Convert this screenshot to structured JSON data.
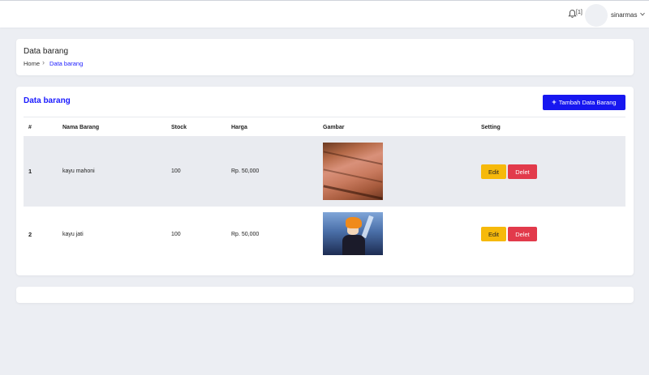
{
  "topbar": {
    "notification_count": "[1]",
    "username": "sinarmas"
  },
  "header": {
    "title": "Data barang",
    "breadcrumb": {
      "home": "Home",
      "separator": "›",
      "current": "Data barang"
    }
  },
  "main": {
    "title": "Data barang",
    "add_button": {
      "icon": "+",
      "label": "Tambah Data Barang"
    },
    "table": {
      "columns": [
        "#",
        "Nama Barang",
        "Stock",
        "Harga",
        "Gambar",
        "Setting"
      ],
      "rows": [
        {
          "no": "1",
          "nama": "kayu mahoni",
          "stock": "100",
          "harga": "Rp. 50,000",
          "image_icon": "wood-plank-image"
        },
        {
          "no": "2",
          "nama": "kayu jati",
          "stock": "100",
          "harga": "Rp. 50,000",
          "image_icon": "anime-character-image"
        }
      ],
      "edit_label": "Edit",
      "delete_label": "Delet"
    }
  },
  "colors": {
    "primary": "#1717f0",
    "link": "#1a1aff",
    "edit": "#f6b90b",
    "delete": "#e23a4b",
    "background": "#eceef3",
    "row_highlight": "#e9ebf0"
  }
}
